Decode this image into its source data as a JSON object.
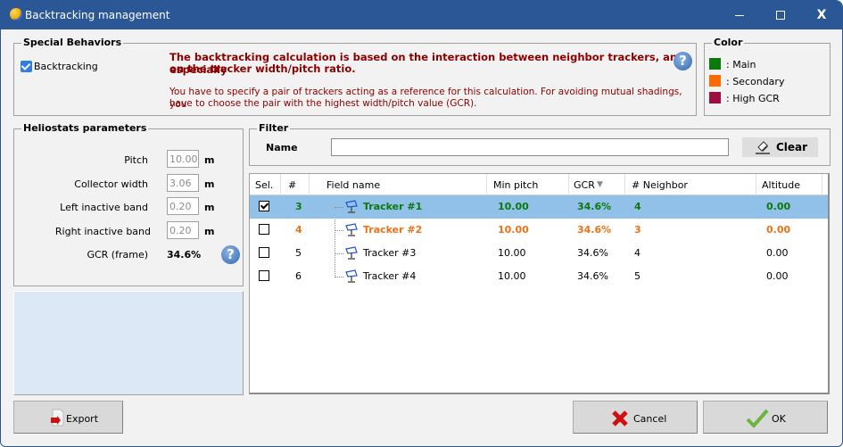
{
  "window": {
    "title": "Backtracking management",
    "controls": {
      "minimize": "minimize",
      "maximize": "maximize",
      "close": "X"
    }
  },
  "special_behaviors": {
    "title": "Special Behaviors",
    "backtracking_label": "Backtracking",
    "backtracking_checked": true,
    "info_bold_line1": "The backtracking calculation is based on the interaction between neighbor trackers, and especially",
    "info_bold_line2": "on the tracker width/pitch ratio.",
    "info_line1": "You have to specify a pair of trackers acting as a reference for this calculation. For avoiding mutual shadings, you",
    "info_line2": "have to choose the pair with the highest width/pitch value (GCR).",
    "help_glyph": "?"
  },
  "color_legend": {
    "title": "Color",
    "items": [
      {
        "label": ": Main",
        "color": "#0a7a0a"
      },
      {
        "label": ": Secondary",
        "color": "#ff6a00"
      },
      {
        "label": ": High GCR",
        "color": "#9b1040"
      }
    ]
  },
  "heliostats": {
    "title": "Heliostats parameters",
    "params": [
      {
        "label": "Pitch",
        "value": "10.00",
        "unit": "m"
      },
      {
        "label": "Collector width",
        "value": "3.06",
        "unit": "m"
      },
      {
        "label": "Left inactive band",
        "value": "0.20",
        "unit": "m"
      },
      {
        "label": "Right inactive band",
        "value": "0.20",
        "unit": "m"
      }
    ],
    "gcr_label": "GCR (frame)",
    "gcr_value": "34.6%",
    "help_glyph": "?"
  },
  "filter": {
    "title": "Filter",
    "name_label": "Name",
    "name_value": "",
    "clear_label": "Clear"
  },
  "grid": {
    "columns": [
      "Sel.",
      "#",
      "Field name",
      "Min pitch",
      "GCR",
      "# Neighbor",
      "Altitude"
    ],
    "sort_column": "GCR",
    "sort_indicator": "▼",
    "rows": [
      {
        "selected": true,
        "checked": true,
        "role": "main",
        "num": "3",
        "name": "Tracker #1",
        "min_pitch": "10.00",
        "gcr": "34.6%",
        "neighbor": "4",
        "altitude": "0.00"
      },
      {
        "selected": false,
        "checked": false,
        "role": "secondary",
        "num": "4",
        "name": "Tracker #2",
        "min_pitch": "10.00",
        "gcr": "34.6%",
        "neighbor": "3",
        "altitude": "0.00"
      },
      {
        "selected": false,
        "checked": false,
        "role": "normal",
        "num": "5",
        "name": "Tracker #3",
        "min_pitch": "10.00",
        "gcr": "34.6%",
        "neighbor": "4",
        "altitude": "0.00"
      },
      {
        "selected": false,
        "checked": false,
        "role": "normal",
        "num": "6",
        "name": "Tracker #4",
        "min_pitch": "10.00",
        "gcr": "34.6%",
        "neighbor": "5",
        "altitude": "0.00"
      }
    ]
  },
  "buttons": {
    "export": "Export",
    "cancel": "Cancel",
    "ok": "OK"
  }
}
